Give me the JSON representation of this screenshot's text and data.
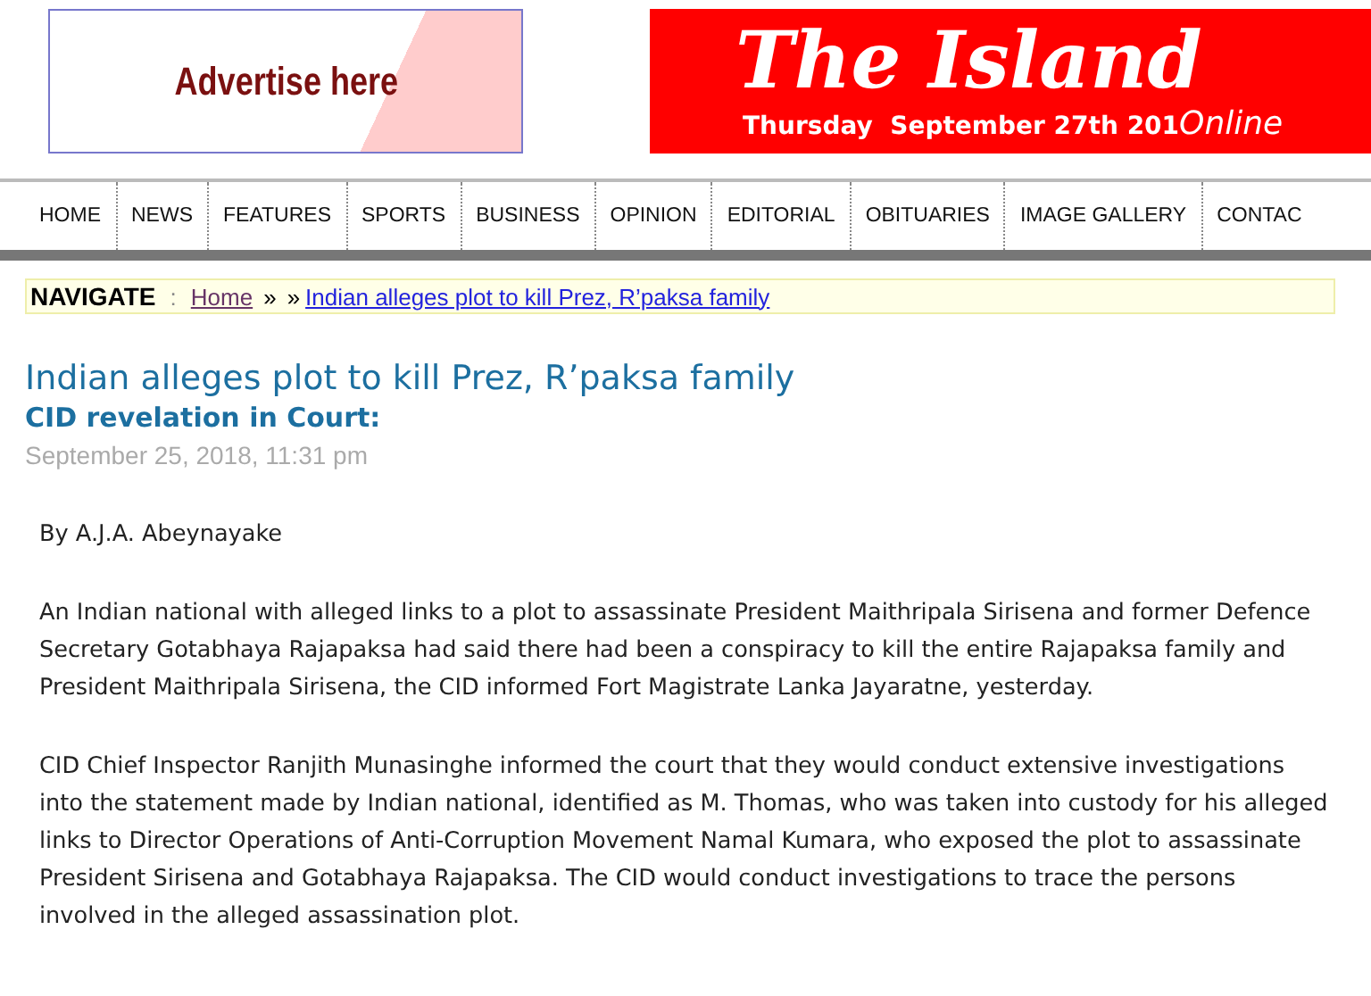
{
  "advert": {
    "text": "Advertise here"
  },
  "masthead": {
    "title": "The Island",
    "date": "Thursday  September 27th 201",
    "tagline": "Online"
  },
  "nav": [
    {
      "label": "HOME"
    },
    {
      "label": "NEWS"
    },
    {
      "label": "FEATURES"
    },
    {
      "label": "SPORTS"
    },
    {
      "label": "BUSINESS"
    },
    {
      "label": "OPINION"
    },
    {
      "label": "EDITORIAL"
    },
    {
      "label": "OBITUARIES"
    },
    {
      "label": "IMAGE GALLERY"
    },
    {
      "label": "CONTAC"
    }
  ],
  "breadcrumb": {
    "label": "NAVIGATE",
    "separator": ":",
    "items": [
      "Home",
      "»",
      "»"
    ],
    "current": "Indian alleges plot to kill Prez, R’paksa family"
  },
  "article": {
    "title": "Indian alleges plot to kill Prez, R’paksa family",
    "subtitle": "CID revelation in Court:",
    "date": "September 25, 2018, 11:31 pm",
    "paragraphs": [
      "By A.J.A. Abeynayake",
      "An Indian national with alleged links to a plot to assassinate President Maithripala Sirisena and former Defence Secretary Gotabhaya Rajapaksa had said there had been a conspiracy to kill the entire Rajapaksa family and President Maithripala Sirisena, the CID informed Fort Magistrate Lanka Jayaratne, yesterday.",
      "CID Chief Inspector Ranjith Munasinghe informed the court that they would conduct extensive investigations into the statement made by Indian national, identified as M. Thomas, who was taken into custody for his alleged links to Director Operations of Anti-Corruption Movement Namal Kumara, who exposed the plot to assassinate President Sirisena and Gotabhaya Rajapaksa. The CID would conduct investigations to trace the persons involved in the alleged assassination plot."
    ]
  }
}
